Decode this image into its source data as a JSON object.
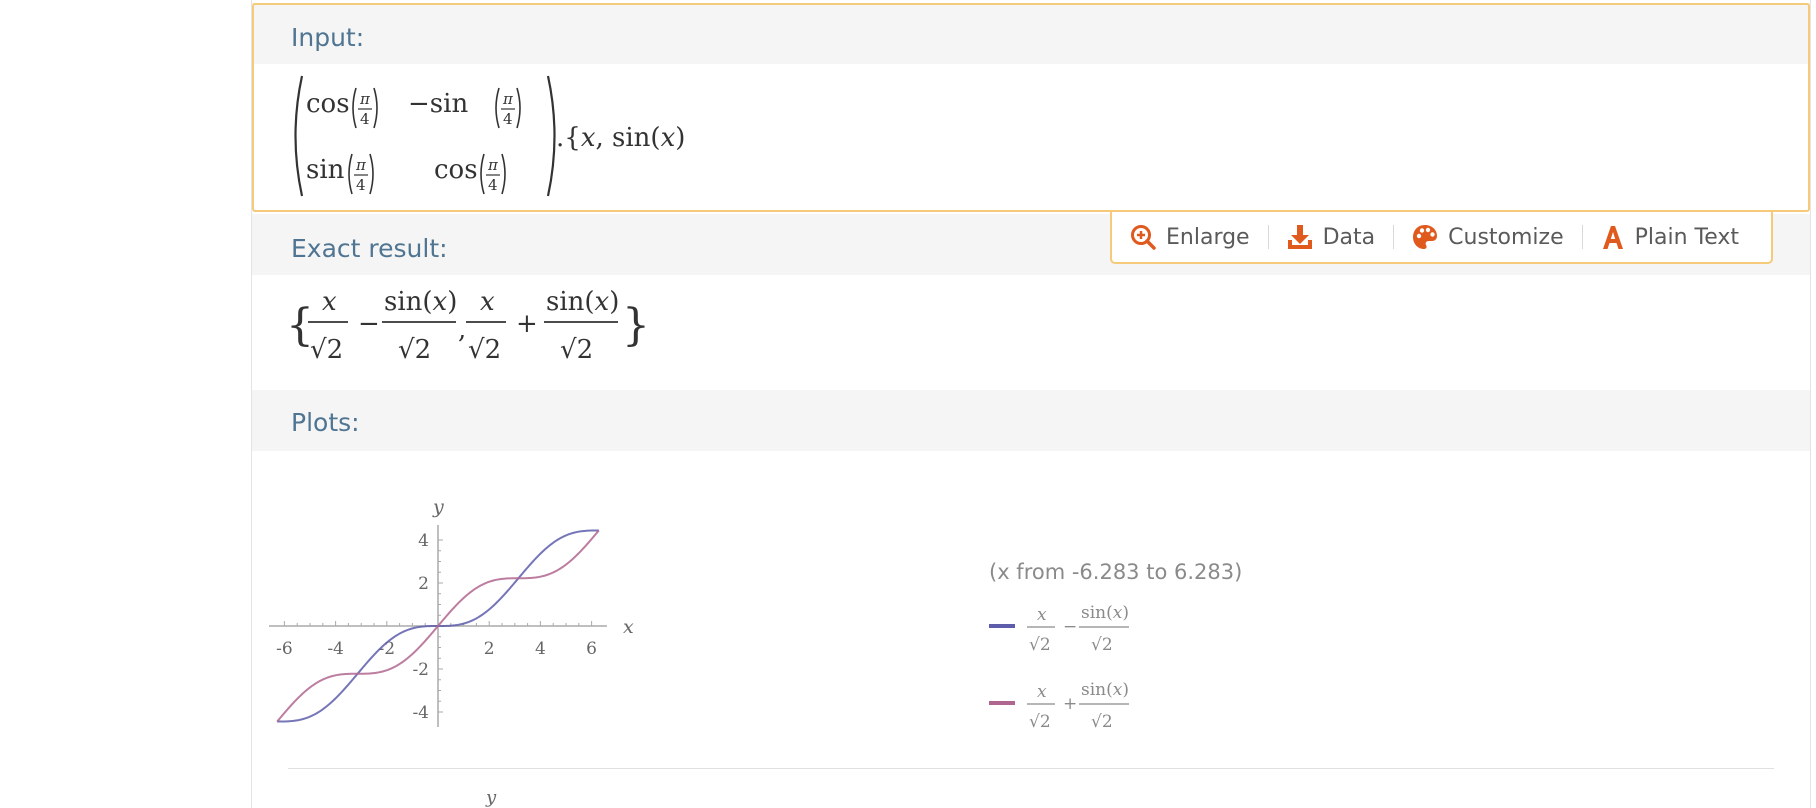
{
  "pods": {
    "input": {
      "title": "Input:"
    },
    "exact": {
      "title": "Exact result:"
    },
    "plots": {
      "title": "Plots:"
    }
  },
  "toolbar": {
    "enlarge": "Enlarge",
    "data": "Data",
    "customize": "Customize",
    "plain_text": "Plain Text"
  },
  "colors": {
    "accent": "#e05a1e",
    "title": "#4f7592",
    "frame": "#f6ca7b",
    "series1": "#5d5dab",
    "series2": "#b0668f"
  },
  "plot": {
    "range_label": "(x from -6.283 to 6.283)",
    "x_label": "x",
    "y_label": "y",
    "x_ticks": [
      "-6",
      "-4",
      "-2",
      "2",
      "4",
      "6"
    ],
    "y_ticks": [
      "4",
      "2",
      "-2",
      "-4"
    ]
  },
  "chart_data": {
    "type": "line",
    "x_range": [
      -6.283,
      6.283
    ],
    "xlim": [
      -6.6,
      6.6
    ],
    "ylim": [
      -4.7,
      4.7
    ],
    "xlabel": "x",
    "ylabel": "y",
    "x_ticks": [
      -6,
      -4,
      -2,
      2,
      4,
      6
    ],
    "y_ticks": [
      -4,
      -2,
      2,
      4
    ],
    "series": [
      {
        "name": "x/√2 − sin(x)/√2",
        "color": "#5d5dab",
        "x": [
          -6.283,
          -5,
          -4,
          -3,
          -2,
          -1,
          0,
          1,
          2,
          3,
          4,
          5,
          6.283
        ],
        "y": [
          -4.44,
          -4.21,
          -3.36,
          -2.02,
          -0.77,
          -0.11,
          0,
          0.11,
          0.77,
          2.02,
          3.36,
          4.21,
          4.44
        ]
      },
      {
        "name": "x/√2 + sin(x)/√2",
        "color": "#b0668f",
        "x": [
          -6.283,
          -5,
          -4,
          -3,
          -2,
          -1,
          0,
          1,
          2,
          3,
          4,
          5,
          6.283
        ],
        "y": [
          -4.44,
          -2.86,
          -2.29,
          -2.22,
          -2.06,
          -1.3,
          0,
          1.3,
          2.06,
          2.22,
          2.29,
          2.86,
          4.44
        ]
      }
    ]
  }
}
